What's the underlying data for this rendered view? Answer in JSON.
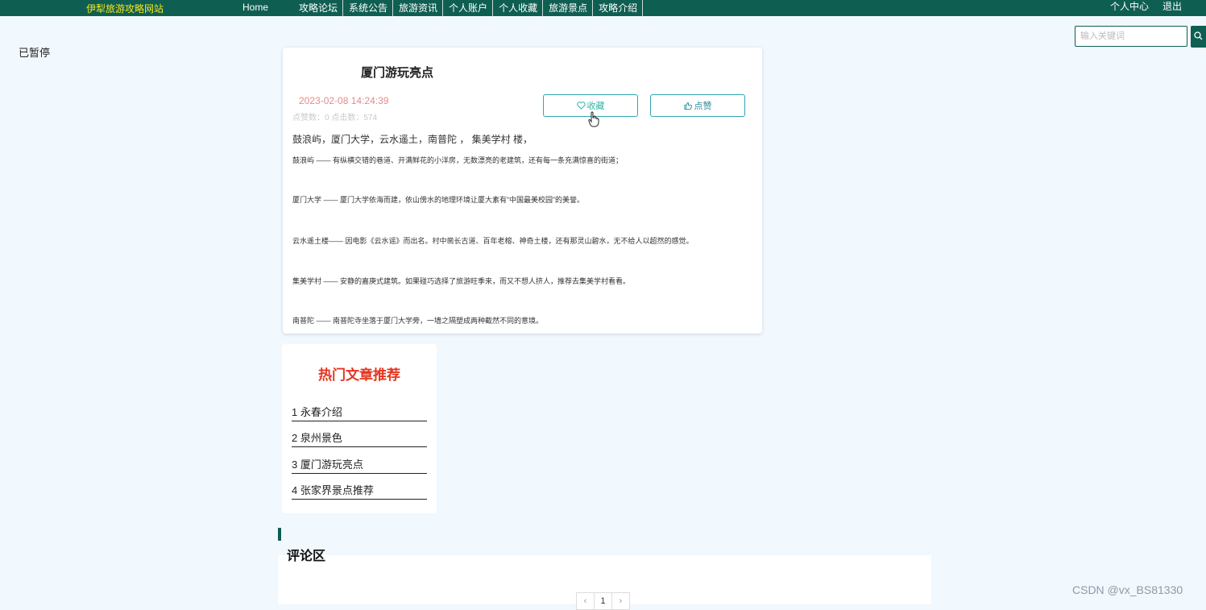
{
  "nav": {
    "brand": "伊犁旅游攻略网站",
    "home": "Home",
    "items": [
      "攻略论坛",
      "系统公告",
      "旅游资讯",
      "个人账户",
      "个人收藏",
      "旅游景点",
      "攻略介绍"
    ],
    "user_center": "个人中心",
    "logout": "退出"
  },
  "side": {
    "status_text": "已暂停"
  },
  "search": {
    "placeholder": "输入关键词"
  },
  "article": {
    "title": "厦门游玩亮点",
    "date": "2023-02-08 14:24:39",
    "stats": "点赞数：0    点击数：574",
    "favorite_label": "收藏",
    "like_label": "点赞",
    "intro": "鼓浪屿，厦门大学，云水遥土，南普陀 ，  集美学村 楼，",
    "paragraphs": [
      "鼓浪屿 —— 有纵横交错的巷道、开满鲜花的小洋房，无数漂亮的老建筑，还有每一条充满惊喜的街道；",
      "厦门大学 —— 厦门大学依海而建，依山傍水的地理环境让厦大素有“中国最美校园”的美誉。",
      " 云水遥土楼—— 因电影《云水谣》而出名。村中凿长古道、百年老榕、神奇土楼，还有那灵山碧水，无不给人以超然的感觉。",
      " 集美学村 —— 安静的嘉庚式建筑。如果碰巧选择了旅游旺季来，而又不想人挤人，推荐去集美学村看看。",
      " 南普陀 —— 南普陀寺坐落于厦门大学旁，一墙之隔塑成两种截然不同的意境。"
    ]
  },
  "hot": {
    "title": "热门文章推荐",
    "items": [
      "1 永春介绍",
      "2 泉州景色",
      "3 厦门游玩亮点",
      "4 张家界景点推荐"
    ]
  },
  "comments": {
    "title": "评论区",
    "pager": {
      "prev": "‹",
      "current": "1",
      "next": "›"
    }
  },
  "watermark": "CSDN @vx_BS81330",
  "colors": {
    "nav_bg": "#0f5e52",
    "brand": "#f6e71e",
    "accent": "#2fa7b5",
    "hot_title": "#e5341f"
  }
}
